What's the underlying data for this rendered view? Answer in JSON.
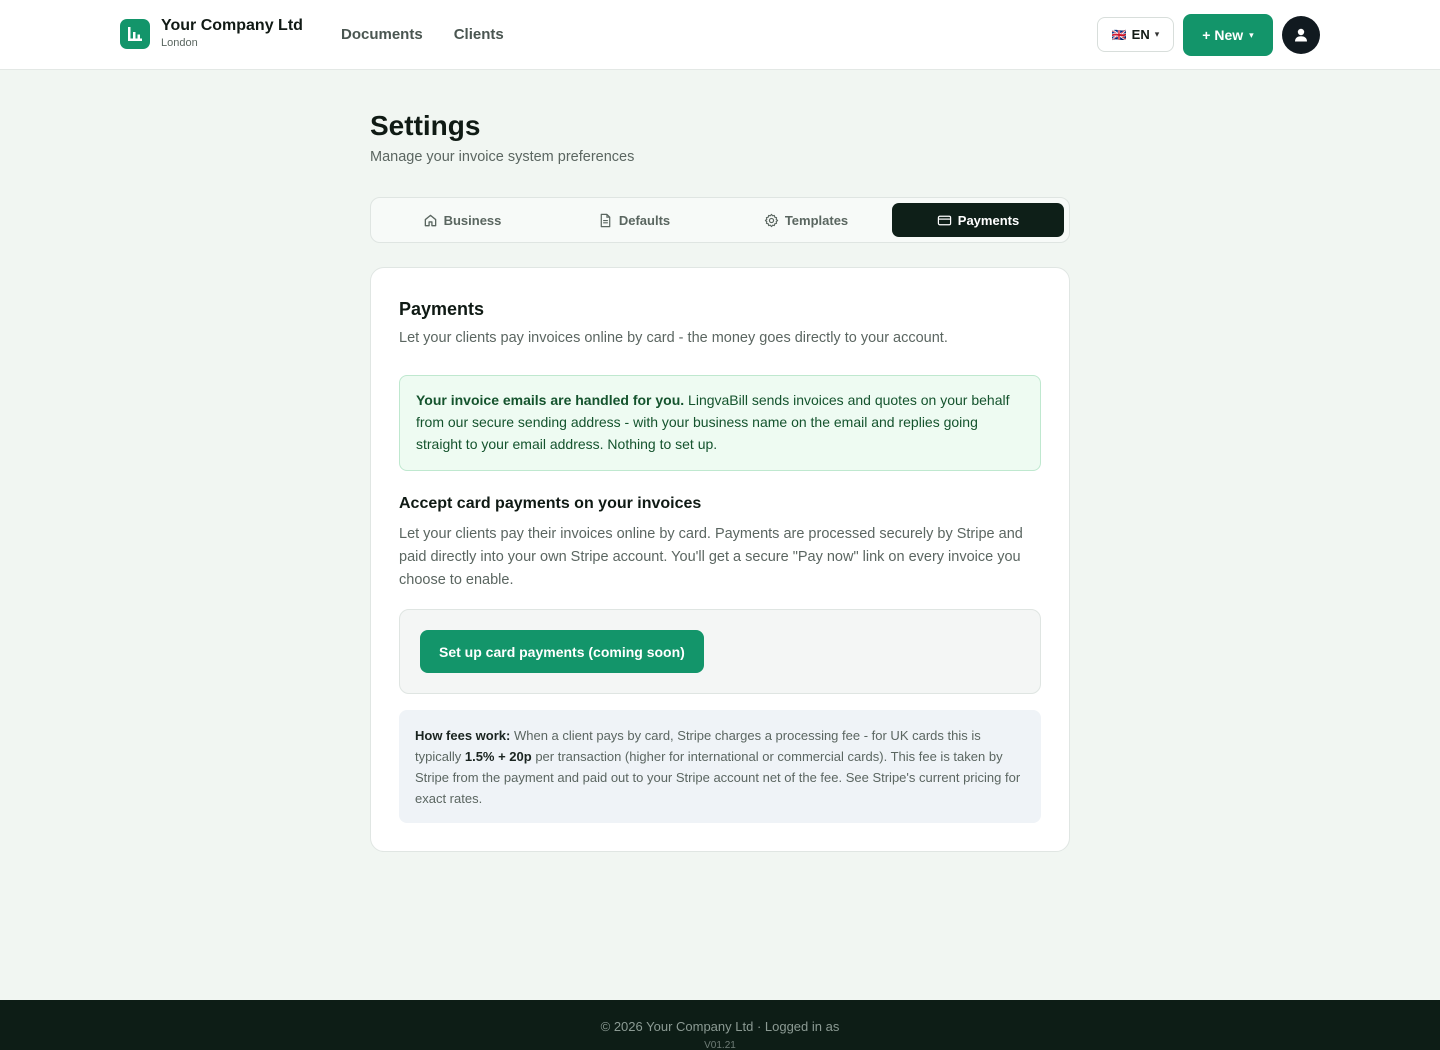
{
  "header": {
    "company_name": "Your Company Ltd",
    "company_city": "London",
    "nav": [
      "Documents",
      "Clients"
    ],
    "language": "EN",
    "language_flag": "🇬🇧",
    "new_button": "+ New"
  },
  "page": {
    "title": "Settings",
    "subtitle": "Manage your invoice system preferences"
  },
  "tabs": [
    {
      "label": "Business",
      "icon": "home-icon"
    },
    {
      "label": "Defaults",
      "icon": "document-icon"
    },
    {
      "label": "Templates",
      "icon": "gear-icon"
    },
    {
      "label": "Payments",
      "icon": "credit-card-icon",
      "active": true
    }
  ],
  "payments": {
    "title": "Payments",
    "description": "Let your clients pay invoices online by card - the money goes directly to your account.",
    "notice_bold": "Your invoice emails are handled for you.",
    "notice_text": " LingvaBill sends invoices and quotes on your behalf from our secure sending address - with your business name on the email and replies going straight to your email address. Nothing to set up.",
    "section_title": "Accept card payments on your invoices",
    "section_text": "Let your clients pay their invoices online by card. Payments are processed securely by Stripe and paid directly into your own Stripe account. You'll get a secure \"Pay now\" link on every invoice you choose to enable.",
    "setup_button": "Set up card payments (coming soon)",
    "fees_label": "How fees work:",
    "fees_text_1": " When a client pays by card, Stripe charges a processing fee - for UK cards this is typically ",
    "fees_rate": "1.5% + 20p",
    "fees_text_2": " per transaction (higher for international or commercial cards). This fee is taken by Stripe from the payment and paid out to your Stripe account net of the fee. See Stripe's current pricing for exact rates."
  },
  "footer": {
    "copyright": "© 2026 Your Company Ltd · Logged in as",
    "version": "V01.21"
  },
  "colors": {
    "brand_green": "#13956a",
    "dark": "#0e1f18",
    "background": "#f1f6f2"
  }
}
